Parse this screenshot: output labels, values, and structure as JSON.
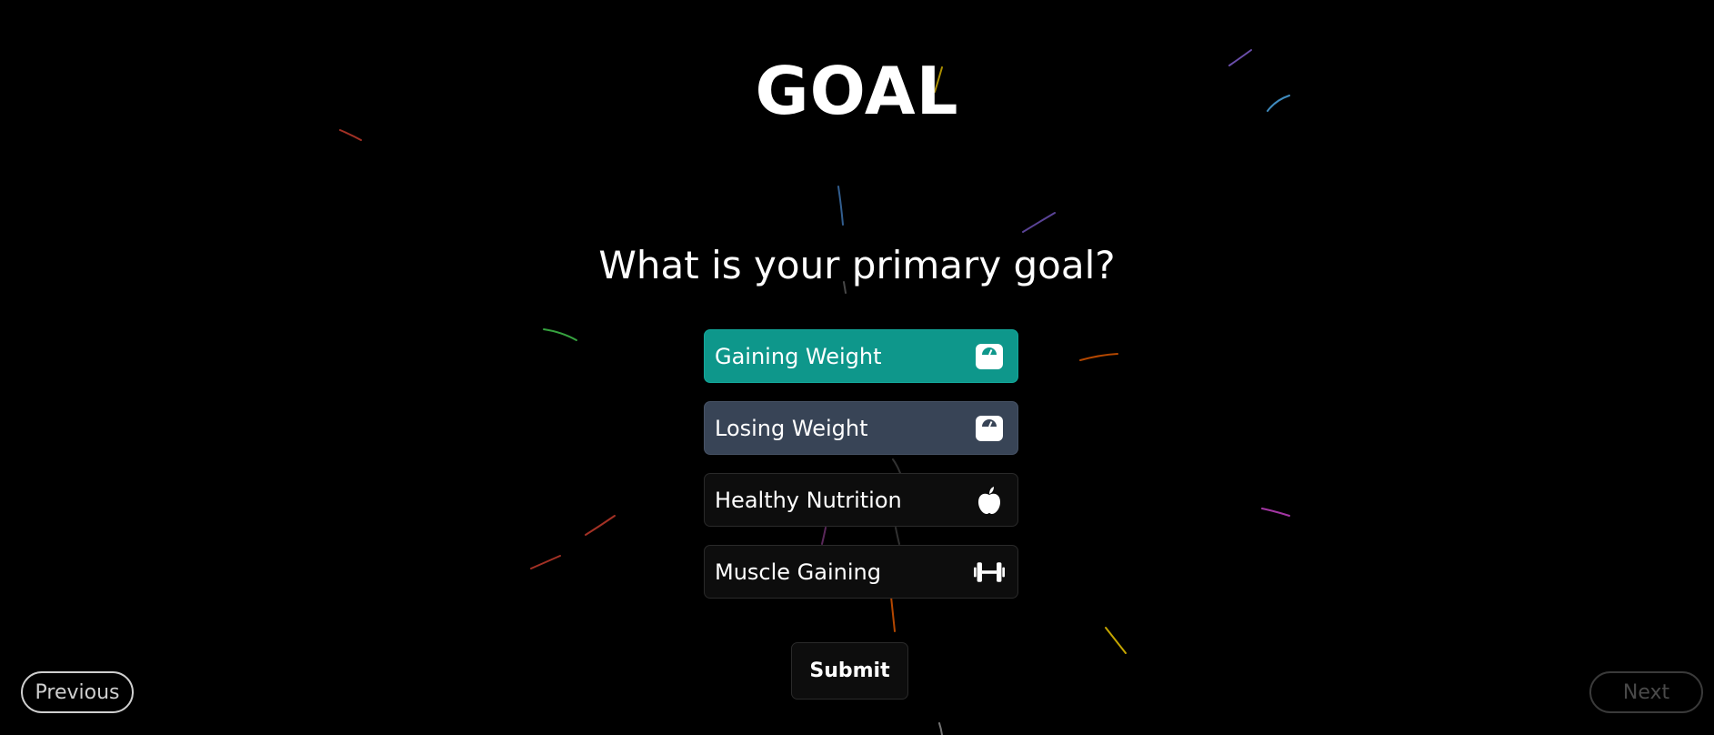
{
  "page": {
    "title": "GOAL",
    "question": "What is your primary goal?"
  },
  "options": [
    {
      "label": "Gaining Weight",
      "icon": "weighing-scale-icon",
      "state": "selected",
      "color": "#0e978b"
    },
    {
      "label": "Losing Weight",
      "icon": "weighing-scale-icon",
      "state": "highlighted",
      "color": "#384456"
    },
    {
      "label": "Healthy Nutrition",
      "icon": "apple-icon",
      "state": "default",
      "color": "#0d0d0d"
    },
    {
      "label": "Muscle Gaining",
      "icon": "dumbbell-icon",
      "state": "default",
      "color": "#0d0d0d"
    }
  ],
  "actions": {
    "submit_label": "Submit"
  },
  "navigation": {
    "previous_label": "Previous",
    "next_label": "Next",
    "next_enabled": false
  },
  "colors": {
    "background": "#000000",
    "accent": "#0e978b",
    "secondary": "#384456"
  }
}
